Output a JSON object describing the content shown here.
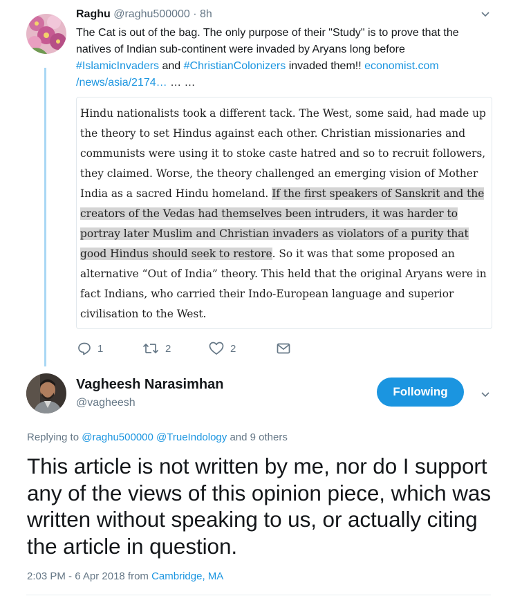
{
  "tweet1": {
    "author_name": "Raghu",
    "author_handle": "@raghu500000",
    "separator": "·",
    "time": "8h",
    "text_part1": "The Cat is out of the bag.  The only purpose of their \"Study\" is to prove that the natives of Indian sub-continent were invaded by Aryans long before ",
    "hashtag1": "#IslamicInvaders",
    "text_and": " and ",
    "hashtag2": "#ChristianColonizers",
    "text_part2": " invaded them!! ",
    "link": "economist.com /news/asia/2174…",
    "ellipsis": " … …",
    "quote": {
      "text_before": "Hindu nationalists took a different tack. The West, some said, had made up the theory to set Hindus against each other. Christian missionaries and communists were using it to stoke caste hatred and so to recruit followers, they claimed. Worse, the theory challenged an emerging vision of Mother India as a sacred Hindu homeland. ",
      "text_highlight": "If the first speakers of Sanskrit and the creators of the Vedas had themselves been intruders, it was harder to portray later Muslim and Christian invaders as violators of a purity that good Hindus should seek to restore",
      "text_after": ". So it was that some proposed an alternative “Out of India” theory. This held that the original Aryans were in fact Indians, who carried their Indo-European language and superior civilisation to the West."
    },
    "actions": {
      "reply_count": "1",
      "retweet_count": "2",
      "like_count": "2"
    }
  },
  "tweet2": {
    "author_name": "Vagheesh Narasimhan",
    "author_handle": "@vagheesh",
    "follow_label": "Following",
    "replying_prefix": "Replying to ",
    "reply_handle1": "@raghu500000",
    "reply_space": " ",
    "reply_handle2": "@TrueIndology",
    "reply_suffix": " and 9 others",
    "text": "This article is not written by me, nor do I support any of the views of this opinion piece, which was written without speaking to us, or actually citing the article in question.",
    "timestamp": "2:03 PM - 6 Apr 2018 from ",
    "location": "Cambridge, MA"
  },
  "colors": {
    "accent": "#1b95e0",
    "muted": "#657786",
    "thread_line": "#a9d7f4",
    "highlight": "#d4d4d4"
  },
  "icons": [
    "chevron-down-icon",
    "reply-icon",
    "retweet-icon",
    "heart-icon",
    "direct-message-icon"
  ]
}
